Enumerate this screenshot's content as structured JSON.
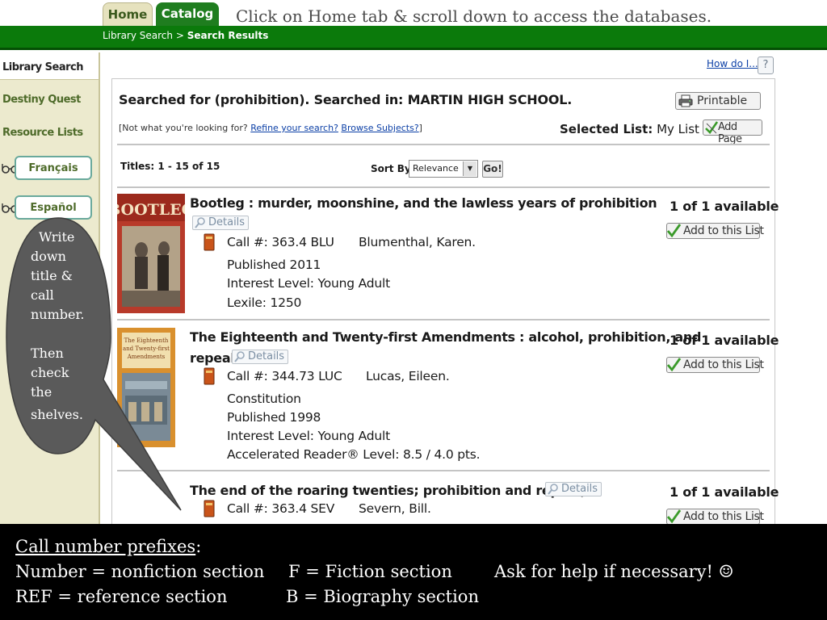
{
  "tabs": {
    "home": "Home",
    "catalog": "Catalog"
  },
  "instruction": "Click on Home tab & scroll down to access the databases.",
  "breadcrumb": {
    "root": "Library Search",
    "separator": ">",
    "current": "Search Results"
  },
  "sidebar": {
    "library_search": "Library Search",
    "destiny_quest": "Destiny Quest",
    "resource_lists": "Resource Lists",
    "francais": "Français",
    "espanol": "Español"
  },
  "help": {
    "how_do_i": "How do I...",
    "question": "?"
  },
  "search": {
    "summary": "Searched for (prohibition). Searched in: MARTIN HIGH SCHOOL.",
    "printable": "Printable",
    "not_looking": "[Not what you're looking for?",
    "refine": "Refine your search?",
    "browse": "Browse Subjects?",
    "not_looking_end": "]",
    "selected_list_label": "Selected List:",
    "selected_list_value": "My List",
    "add_page": "Add Page",
    "titles_count": "Titles: 1 - 15 of 15",
    "sort_by_label": "Sort By",
    "sort_value": "Relevance",
    "go": "Go!"
  },
  "results": [
    {
      "title": "Bootleg : murder, moonshine, and the lawless years of prohibition",
      "details": "Details",
      "call_number": "Call #: 363.4 BLU",
      "author": "Blumenthal, Karen.",
      "lines": [
        "Published 2011",
        "Interest Level: Young Adult",
        "Lexile: 1250"
      ],
      "availability": "1 of 1 available",
      "add_to_list": "Add to this List",
      "cover_text": "BOOTLEG"
    },
    {
      "title_line1": "The Eighteenth and Twenty-first Amendments : alcohol, prohibition, and",
      "title_line2": "repeal",
      "details": "Details",
      "call_number": "Call #: 344.73 LUC",
      "author": "Lucas, Eileen.",
      "lines": [
        "Constitution",
        "Published 1998",
        "Interest Level: Young Adult",
        "Accelerated Reader® Level: 8.5 / 4.0 pts."
      ],
      "availability": "1 of 1 available",
      "add_to_list": "Add to this List",
      "cover_text_1": "The Eighteenth",
      "cover_text_2": "and Twenty-first",
      "cover_text_3": "Amendments"
    },
    {
      "title": "The end of the roaring twenties; prohibition and repeal,",
      "details": "Details",
      "call_number": "Call #: 363.4 SEV",
      "author": "Severn, Bill.",
      "availability": "1 of 1 available",
      "add_to_list": "Add to this List"
    }
  ],
  "callout": {
    "lines": [
      "Write",
      "down",
      "title &",
      "call",
      "number.",
      "",
      "Then",
      "check",
      "the",
      "shelves."
    ]
  },
  "bottom": {
    "heading": "Call number prefixes",
    "heading_colon": ":",
    "number": "Number = nonfiction section",
    "fiction": "F = Fiction section",
    "help": "Ask for help if necessary! ☺",
    "reference": "REF = reference section",
    "biography": "B = Biography section"
  },
  "colors": {
    "green_bar": "#0b7a0b",
    "catalog_tab": "#1f7d1f",
    "sidebar_bg": "#eceace",
    "callout": "#5a5a5a",
    "bottom_bar": "#000000"
  }
}
